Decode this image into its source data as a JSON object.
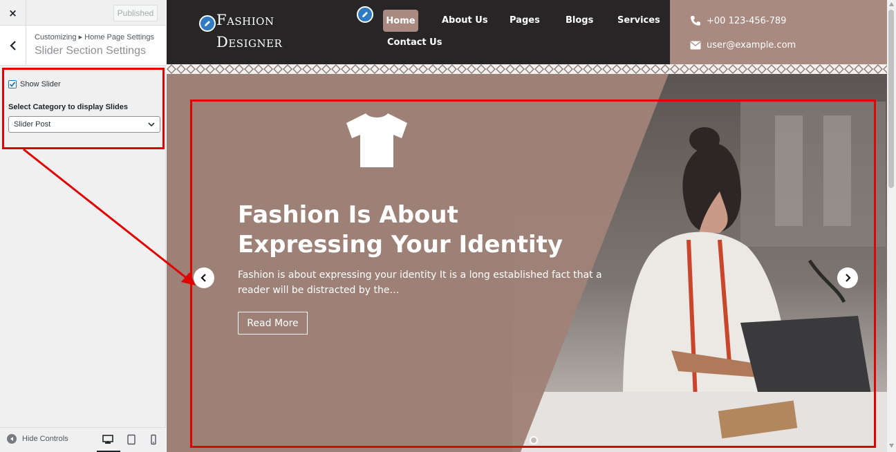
{
  "sidebar": {
    "close_label": "×",
    "publish_label": "Published",
    "breadcrumb": "Customizing ▸ Home Page Settings",
    "section_title": "Slider Section Settings",
    "show_slider_label": "Show Slider",
    "show_slider_checked": true,
    "category_label": "Select Category to display Slides",
    "category_selected": "Slider Post",
    "hide_controls_label": "Hide Controls",
    "devices": [
      "desktop-icon",
      "tablet-icon",
      "mobile-icon"
    ]
  },
  "site": {
    "logo_line1": "Fashion",
    "logo_line2": "Designer",
    "nav": [
      "Home",
      "About Us",
      "Pages",
      "Blogs",
      "Services",
      "Contact Us"
    ],
    "active_nav": "Home",
    "phone": "+00 123-456-789",
    "email": "user@example.com"
  },
  "slider": {
    "title": "Fashion Is About Expressing Your Identity",
    "text": "Fashion is about expressing your identity It is a long established fact that a reader will be distracted by the…",
    "button_label": "Read More",
    "slide_count": 1,
    "active_slide": 1
  },
  "colors": {
    "header_dark": "#272525",
    "accent_tan": "#a88a80",
    "annotation_red": "#e00000",
    "pencil_blue": "#2f7ac1"
  }
}
